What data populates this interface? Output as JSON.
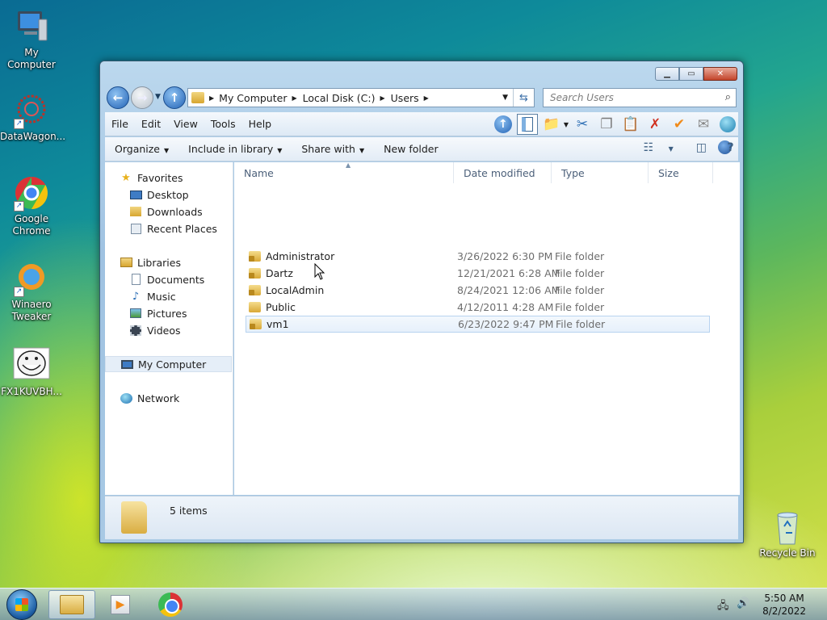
{
  "desktop": {
    "icons": [
      {
        "label": "My Computer"
      },
      {
        "label": "DataWagon..."
      },
      {
        "label": "Google Chrome"
      },
      {
        "label": "Winaero Tweaker"
      },
      {
        "label": "FX1KUVBH..."
      },
      {
        "label": "Recycle Bin"
      }
    ]
  },
  "window": {
    "breadcrumb": [
      "My Computer",
      "Local Disk (C:)",
      "Users"
    ],
    "search_placeholder": "Search Users",
    "menu": [
      "File",
      "Edit",
      "View",
      "Tools",
      "Help"
    ],
    "commands": {
      "organize": "Organize",
      "include": "Include in library",
      "share": "Share with",
      "new_folder": "New folder"
    },
    "nav": {
      "favorites": "Favorites",
      "desktop": "Desktop",
      "downloads": "Downloads",
      "recent": "Recent Places",
      "libraries": "Libraries",
      "documents": "Documents",
      "music": "Music",
      "pictures": "Pictures",
      "videos": "Videos",
      "computer": "My Computer",
      "network": "Network"
    },
    "columns": {
      "name": "Name",
      "date": "Date modified",
      "type": "Type",
      "size": "Size"
    },
    "files": [
      {
        "name": "Administrator",
        "date": "3/26/2022 6:30 PM",
        "type": "File folder"
      },
      {
        "name": "Dartz",
        "date": "12/21/2021 6:28 AM",
        "type": "File folder"
      },
      {
        "name": "LocalAdmin",
        "date": "8/24/2021 12:06 AM",
        "type": "File folder"
      },
      {
        "name": "Public",
        "date": "4/12/2011 4:28 AM",
        "type": "File folder"
      },
      {
        "name": "vm1",
        "date": "6/23/2022 9:47 PM",
        "type": "File folder"
      }
    ],
    "status_count": "5 items"
  },
  "taskbar": {
    "time": "5:50 AM",
    "date": "8/2/2022"
  }
}
